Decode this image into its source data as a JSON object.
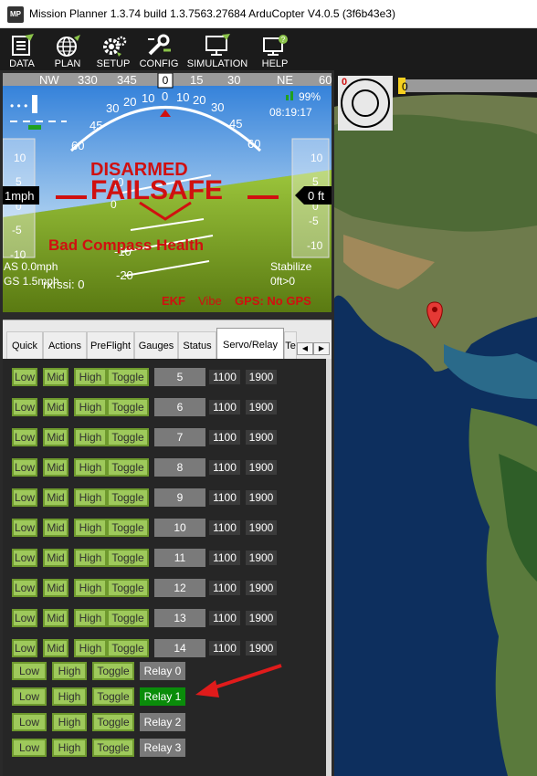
{
  "window": {
    "title": "Mission Planner 1.3.74 build 1.3.7563.27684 ArduCopter V4.0.5 (3f6b43e3)",
    "icon_text": "MP"
  },
  "toolbar": [
    {
      "label": "DATA",
      "icon": "data-icon"
    },
    {
      "label": "PLAN",
      "icon": "plan-globe-icon"
    },
    {
      "label": "SETUP",
      "icon": "setup-gear-icon"
    },
    {
      "label": "CONFIG",
      "icon": "config-wrench-icon"
    },
    {
      "label": "SIMULATION",
      "icon": "simulation-monitor-icon"
    },
    {
      "label": "HELP",
      "icon": "help-monitor-icon"
    }
  ],
  "hud": {
    "heading_labels": [
      "NW",
      "330",
      "345",
      "0",
      "15",
      "30",
      "NE",
      "60"
    ],
    "heading_value": "0",
    "battery": "99%",
    "time": "08:19:17",
    "status_armed": "DISARMED",
    "status_failsafe": "FAILSAFE",
    "message": "Bad Compass Health",
    "airspeed": "AS 0.0mph",
    "groundspeed": "GS 1.5mph",
    "rssi": "rxrssi: 0",
    "speed_box": "1mph",
    "alt_box": "0 ft",
    "mode": "Stabilize",
    "alt_target": "0ft>0",
    "ekf": "EKF",
    "vibe": "Vibe",
    "gps": "GPS: No GPS",
    "left_ticks": [
      "10",
      "5",
      "0",
      "-5",
      "-10"
    ],
    "right_ticks": [
      "10",
      "5",
      "0",
      "-5",
      "-10"
    ],
    "pitch_labels": [
      "10",
      "-10",
      "-20"
    ],
    "roll_labels": [
      "60",
      "45",
      "30",
      "20",
      "10",
      "0",
      "10",
      "20",
      "30",
      "45",
      "60"
    ]
  },
  "tabs": [
    "Quick",
    "Actions",
    "PreFlight",
    "Gauges",
    "Status",
    "Servo/Relay",
    "Te"
  ],
  "active_tab": "Servo/Relay",
  "servo_buttons": {
    "low": "Low",
    "mid": "Mid",
    "high": "High",
    "toggle": "Toggle"
  },
  "servos": [
    {
      "channel": "5",
      "low": "1100",
      "high": "1900"
    },
    {
      "channel": "6",
      "low": "1100",
      "high": "1900"
    },
    {
      "channel": "7",
      "low": "1100",
      "high": "1900"
    },
    {
      "channel": "8",
      "low": "1100",
      "high": "1900"
    },
    {
      "channel": "9",
      "low": "1100",
      "high": "1900"
    },
    {
      "channel": "10",
      "low": "1100",
      "high": "1900"
    },
    {
      "channel": "11",
      "low": "1100",
      "high": "1900"
    },
    {
      "channel": "12",
      "low": "1100",
      "high": "1900"
    },
    {
      "channel": "13",
      "low": "1100",
      "high": "1900"
    },
    {
      "channel": "14",
      "low": "1100",
      "high": "1900"
    }
  ],
  "relays": [
    {
      "label": "Relay 0",
      "active": false
    },
    {
      "label": "Relay 1",
      "active": true
    },
    {
      "label": "Relay 2",
      "active": false
    },
    {
      "label": "Relay 3",
      "active": false
    }
  ],
  "map": {
    "zoom_label": "0",
    "progress_label": "0"
  },
  "colors": {
    "button_green": "#9ec95b",
    "relay_active": "#0a8c0a",
    "hud_red": "#d01010",
    "arrow_red": "#e01b1b"
  }
}
